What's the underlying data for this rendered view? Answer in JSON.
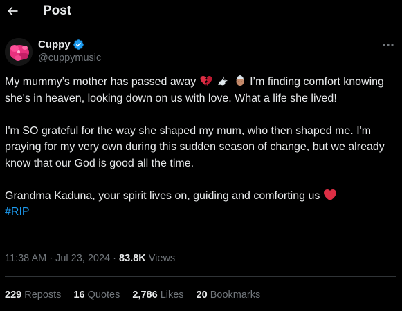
{
  "header": {
    "title": "Post",
    "back_icon": "arrow-left-icon"
  },
  "author": {
    "display_name": "Cuppy",
    "handle": "@cuppymusic",
    "verified": true,
    "verified_color": "#1d9bf0",
    "avatar_color": "#e8317e"
  },
  "more_icon": "more-horizontal-icon",
  "tweet": {
    "line1_text": "My mummy’s mother has passed away",
    "line1_emojis": [
      "broken-heart-emoji",
      "dove-emoji",
      "old-woman-emoji"
    ],
    "line1_rest": "I’m finding comfort knowing she's in heaven, looking down on us with love. What a life she lived!",
    "para2": "I'm SO grateful for the way she shaped my mum, who then shaped me. I'm praying for my very own during this sudden season of change, but we already know that our God is good all the time.",
    "para3_text": "Grandma Kaduna, your spirit lives on, guiding and comforting us",
    "para3_emoji": "red-heart-emoji",
    "hashtag": "#RIP",
    "hashtag_color": "#1d9bf0"
  },
  "meta": {
    "time": "11:38 AM",
    "separator": "·",
    "date": "Jul 23, 2024",
    "views_count": "83.8K",
    "views_label": "Views"
  },
  "stats": {
    "reposts_count": "229",
    "reposts_label": "Reposts",
    "quotes_count": "16",
    "quotes_label": "Quotes",
    "likes_count": "2,786",
    "likes_label": "Likes",
    "bookmarks_count": "20",
    "bookmarks_label": "Bookmarks"
  }
}
